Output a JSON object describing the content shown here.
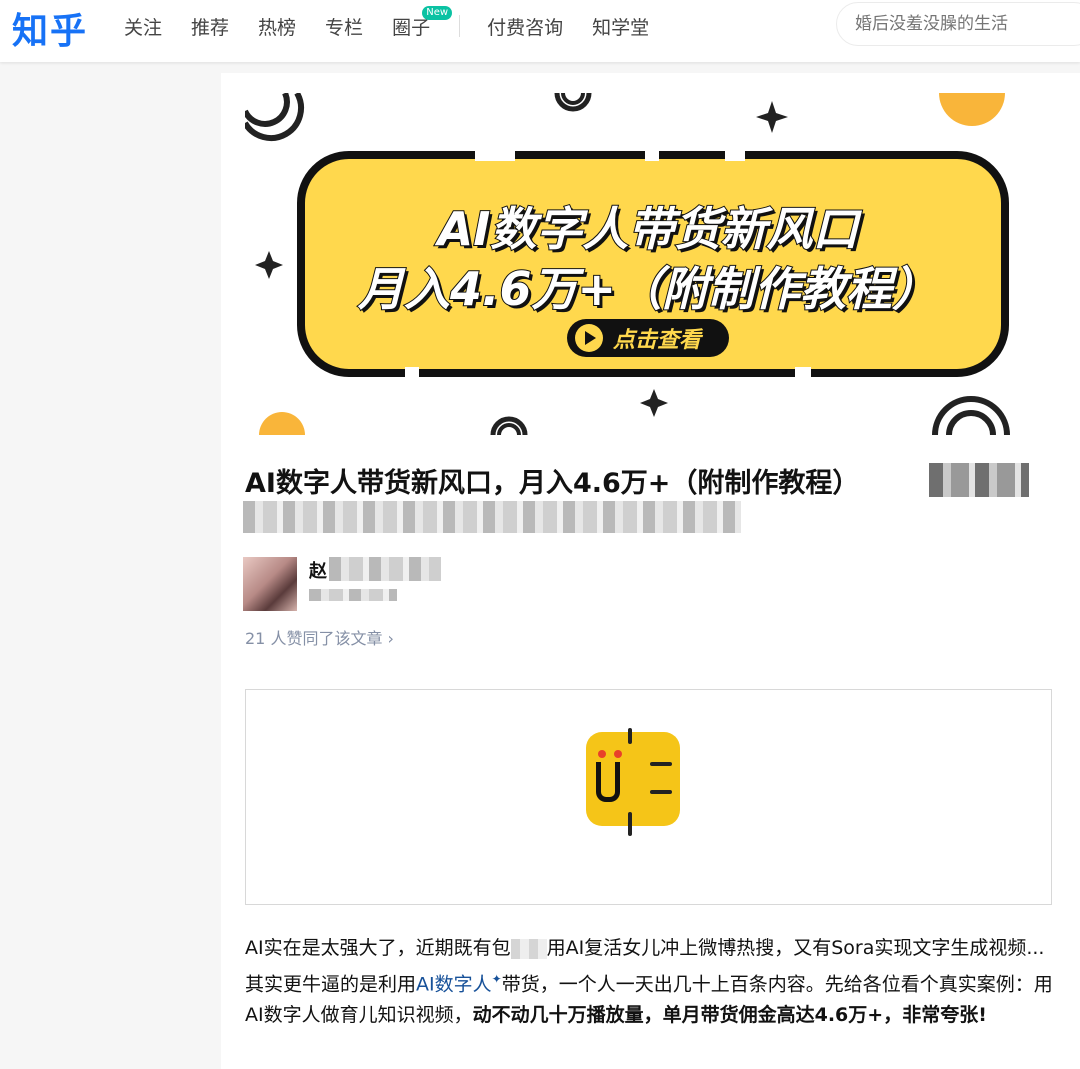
{
  "brand": {
    "logo": "知乎",
    "color": "#1772f6"
  },
  "nav": {
    "items": [
      {
        "label": "关注"
      },
      {
        "label": "推荐"
      },
      {
        "label": "热榜"
      },
      {
        "label": "专栏"
      },
      {
        "label": "圈子",
        "badge": "New"
      },
      {
        "label": "付费咨询"
      },
      {
        "label": "知学堂"
      }
    ]
  },
  "search": {
    "placeholder": "婚后没羞没臊的生活"
  },
  "banner": {
    "line1": "AI数字人带货新风口",
    "line2": "月入4.6万+（附制作教程）",
    "cta": "点击查看",
    "colors": {
      "fill": "#ffd84d",
      "outline": "#111111",
      "accent": "#f9b53a"
    }
  },
  "article": {
    "title": "AI数字人带货新风口，月入4.6万+（附制作教程）",
    "author_initial": "赵",
    "upvotes": "21 人赞同了该文章 ›",
    "body": {
      "p1": "AI实在是太强大了，近期既有包",
      "p2": "用AI复活女儿冲上微博热搜，又有Sora实现文字生成视频...其实更牛逼的是利用",
      "link": "AI数字人",
      "p3": "带货，一个人一天出几十上百条内容。先给各位看个真实案例：用AI数字人做育儿知识视频，",
      "bold": "动不动几十万播放量，单月带货佣金高达4.6万+，非常夸张!"
    }
  },
  "video": {
    "icon": "app-logo-icon",
    "icon_color": "#f5c518"
  }
}
